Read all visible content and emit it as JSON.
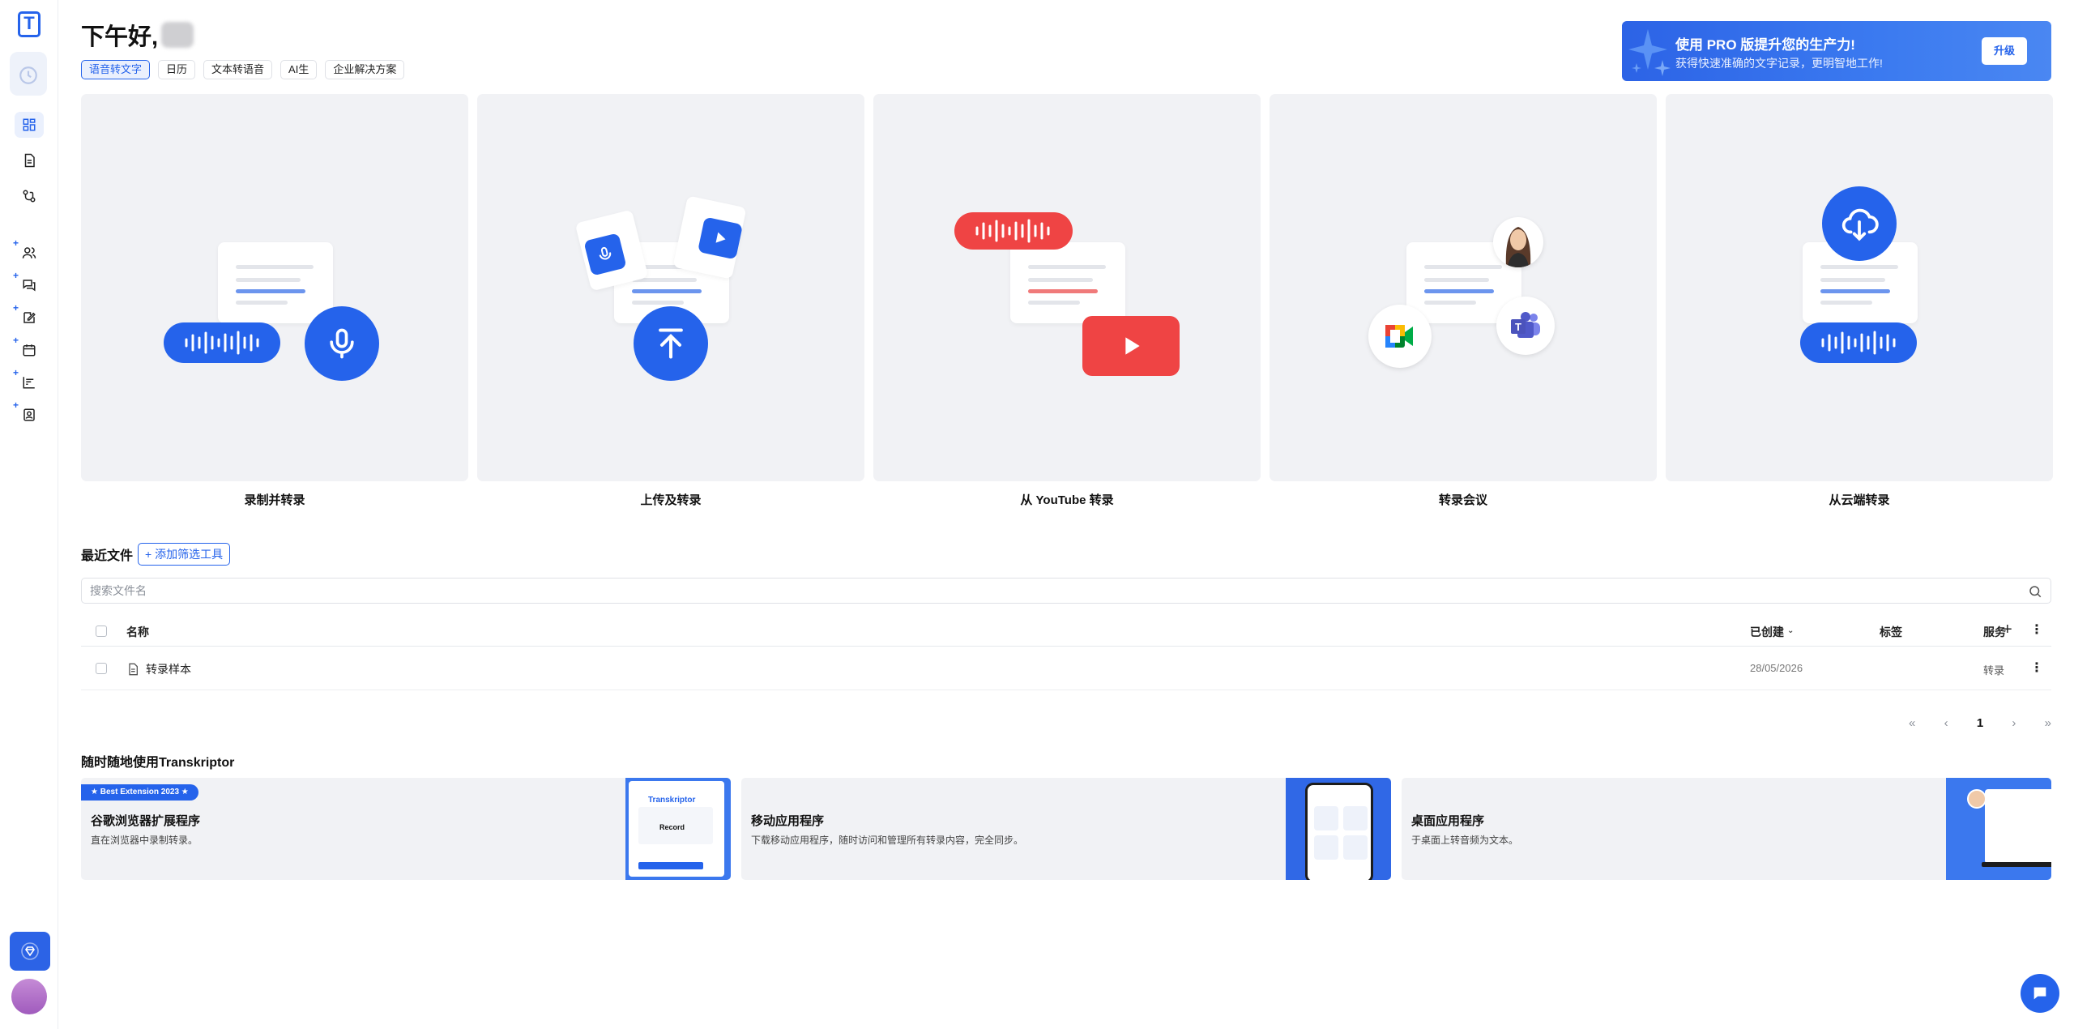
{
  "greeting": {
    "text": "下午好,"
  },
  "tabs": [
    {
      "label": "语音转文字",
      "active": true
    },
    {
      "label": "日历"
    },
    {
      "label": "文本转语音"
    },
    {
      "label": "AI生"
    },
    {
      "label": "企业解决方案"
    }
  ],
  "banner": {
    "title": "使用 PRO 版提升您的生产力!",
    "subtitle": "获得快速准确的文字记录，更明智地工作!",
    "button": "升级"
  },
  "sidebar": {
    "logo": "T",
    "items": [
      {
        "icon": "clock-icon"
      },
      {
        "icon": "dashboard-icon",
        "active": true
      },
      {
        "icon": "document-icon"
      },
      {
        "icon": "workflow-icon"
      },
      {
        "icon": "add-users-icon"
      },
      {
        "icon": "add-chat-icon"
      },
      {
        "icon": "add-edit-icon"
      },
      {
        "icon": "add-calendar-icon"
      },
      {
        "icon": "add-chart-icon"
      },
      {
        "icon": "add-contact-icon"
      }
    ]
  },
  "cards": [
    {
      "label": "录制并转录"
    },
    {
      "label": "上传及转录"
    },
    {
      "label": "从 YouTube 转录"
    },
    {
      "label": "转录会议"
    },
    {
      "label": "从云端转录"
    }
  ],
  "recent": {
    "title": "最近文件",
    "filter_button": "添加筛选工具",
    "search_placeholder": "搜索文件名",
    "columns": {
      "name": "名称",
      "created": "已创建",
      "tags": "标签",
      "service": "服务"
    },
    "rows": [
      {
        "name": "转录样本",
        "created": "28/05/2026",
        "tags": "",
        "service": "转录"
      }
    ],
    "pager": {
      "first": "«",
      "prev": "‹",
      "current": "1",
      "next": "›",
      "last": "»"
    }
  },
  "anywhere": {
    "title": "随时随地使用Transkriptor",
    "promos": [
      {
        "badge": "★ Best Extension 2023 ★",
        "title": "谷歌浏览器扩展程序",
        "desc": "直在浏览器中录制转录。",
        "mock_brand": "Transkriptor",
        "mock_action": "Record"
      },
      {
        "title": "移动应用程序",
        "desc": "下载移动应用程序，随时访问和管理所有转录内容，完全同步。"
      },
      {
        "title": "桌面应用程序",
        "desc": "于桌面上转音频为文本。"
      }
    ]
  },
  "colors": {
    "accent": "#2563eb",
    "youtube": "#ef4444",
    "card_bg": "#f1f2f5"
  }
}
